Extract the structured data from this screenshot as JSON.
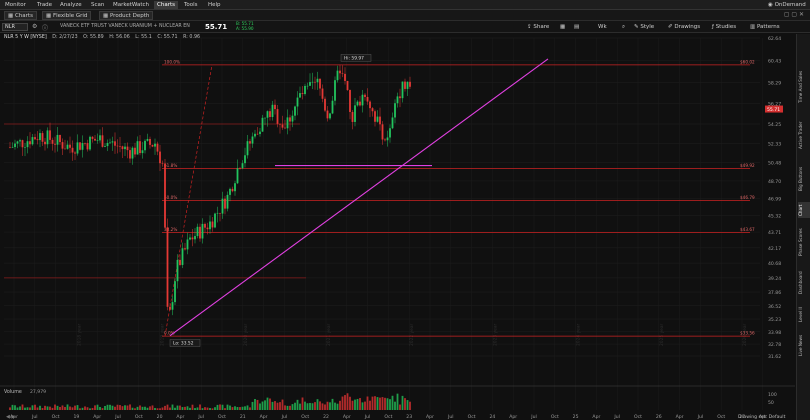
{
  "menu": {
    "items": [
      "Monitor",
      "Trade",
      "Analyze",
      "Scan",
      "MarketWatch",
      "Charts",
      "Tools",
      "Help"
    ],
    "active": "Charts",
    "on_demand": "OnDemand"
  },
  "tabs": {
    "charts": "Charts",
    "flexible_grid": "Flexible Grid",
    "product_depth": "Product Depth"
  },
  "symbol_bar": {
    "symbol": "NLR",
    "description": "VANECK ETF TRUST VANECK URANIUM + NUCLEAR EN",
    "last": "55.71",
    "bid": "B: 55.71",
    "ask": "A: 55.90",
    "share": "Share",
    "period": "Wk",
    "style": "Style",
    "drawings": "Drawings",
    "studies": "Studies",
    "patterns": "Patterns"
  },
  "price_header": {
    "title": "NLR 5 Y W [NYSE]",
    "date": "D: 2/27/23",
    "open": "O: 55.89",
    "high": "H: 56.06",
    "low": "L: 55.1",
    "close": "C: 55.71",
    "range": "R: 0.96"
  },
  "chart_data": {
    "type": "candlestick",
    "ylim": [
      31.62,
      62.64
    ],
    "y_ticks": [
      62.64,
      60.43,
      58.29,
      56.27,
      54.25,
      52.33,
      50.48,
      48.7,
      46.99,
      45.32,
      43.71,
      42.17,
      40.68,
      39.24,
      37.86,
      36.52,
      35.23,
      33.98,
      32.78,
      31.62
    ],
    "x_ticks": [
      "Apr",
      "Jul",
      "Oct",
      "19",
      "Apr",
      "Jul",
      "Oct",
      "20",
      "Apr",
      "Jul",
      "Oct",
      "21",
      "Apr",
      "Jul",
      "Oct",
      "22",
      "Apr",
      "Jul",
      "Oct",
      "23",
      "Apr",
      "Jul",
      "Oct",
      "24",
      "Apr",
      "Jul",
      "Oct",
      "25",
      "Apr",
      "Jul",
      "Oct",
      "26",
      "Apr",
      "Jul",
      "Oct",
      "27",
      "Apr"
    ],
    "year_watermarks": [
      "2018 year",
      "2019 year",
      "2020 year",
      "2021 year",
      "2022 year",
      "2023 year",
      "2024 year",
      "2025 year",
      "2026 year"
    ],
    "current_price": 55.71,
    "high_label": "Hi: 59.97",
    "low_label": "Lo: 33.52",
    "fibonacci": [
      {
        "pct": "100.0%",
        "price": 60.02,
        "price_label": "$60.02"
      },
      {
        "pct": "61.8%",
        "price": 49.92,
        "price_label": "$49.92"
      },
      {
        "pct": "50.0%",
        "price": 46.79,
        "price_label": "$46.79"
      },
      {
        "pct": "38.2%",
        "price": 43.67,
        "price_label": "$43.67"
      },
      {
        "pct": "0.0%",
        "price": 33.56,
        "price_label": "$33.56"
      }
    ],
    "support_level": 50.2,
    "horizontal_levels": [
      54.25,
      39.24
    ],
    "volume": {
      "label": "Volume",
      "value": "27,979",
      "ylim": [
        0,
        100
      ],
      "y_ticks": [
        100,
        50
      ]
    }
  },
  "colors": {
    "bull": "#22c55e",
    "bear": "#e53935",
    "fib": "#cc2222",
    "trend": "#e040e0",
    "price_tag": "#d32f2f"
  },
  "side_tabs": [
    "Time And Sales",
    "Active Trader",
    "Big Buttons",
    "Chart",
    "Phase Scores",
    "Dashboard",
    "Level II",
    "Live News"
  ],
  "footer": {
    "drawing_set": "Drawing set: Default"
  }
}
